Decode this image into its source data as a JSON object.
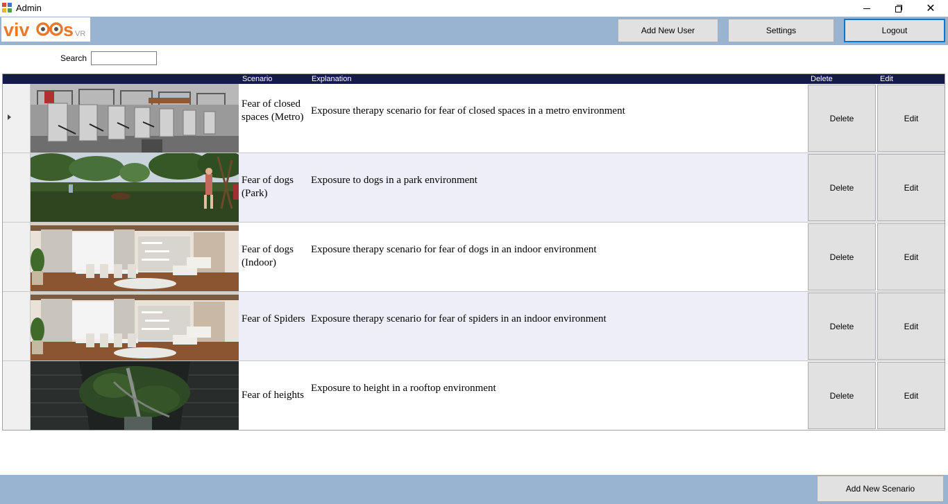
{
  "window": {
    "title": "Admin",
    "icon": "app-icon"
  },
  "brand": {
    "logo_main": "VIVOOS",
    "logo_sub": "VR"
  },
  "header": {
    "add_user_label": "Add New User",
    "settings_label": "Settings",
    "logout_label": "Logout"
  },
  "search": {
    "label": "Search",
    "value": ""
  },
  "table": {
    "columns": {
      "scenario": "Scenario",
      "explanation": "Explanation",
      "delete": "Delete",
      "edit": "Edit"
    },
    "rows": [
      {
        "scenario": "Fear of closed spaces (Metro)",
        "explanation": "Exposure therapy scenario for fear of closed spaces in a metro environment",
        "delete_label": "Delete",
        "edit_label": "Edit",
        "thumbnail": "metro-scene"
      },
      {
        "scenario": "Fear of dogs (Park)",
        "explanation": "Exposure to dogs in a park environment",
        "delete_label": "Delete",
        "edit_label": "Edit",
        "thumbnail": "park-scene"
      },
      {
        "scenario": "Fear of dogs (Indoor)",
        "explanation": "Exposure therapy scenario for fear of dogs in an indoor environment",
        "delete_label": "Delete",
        "edit_label": "Edit",
        "thumbnail": "living-room-scene"
      },
      {
        "scenario": "Fear of Spiders",
        "explanation": "Exposure therapy scenario for fear of spiders in an indoor environment",
        "delete_label": "Delete",
        "edit_label": "Edit",
        "thumbnail": "living-room-scene"
      },
      {
        "scenario": "Fear of heights",
        "explanation": "Exposure to height in a rooftop environment",
        "delete_label": "Delete",
        "edit_label": "Edit",
        "thumbnail": "rooftop-scene"
      }
    ]
  },
  "footer": {
    "add_scenario_label": "Add New Scenario"
  },
  "colors": {
    "band": "#99b4d1",
    "grid_header": "#141a4a",
    "alt_row": "#eeeef8",
    "button": "#e1e1e1",
    "focus_border": "#0078d7",
    "logo_orange": "#e8792b",
    "logo_gray": "#9a9a9a"
  }
}
